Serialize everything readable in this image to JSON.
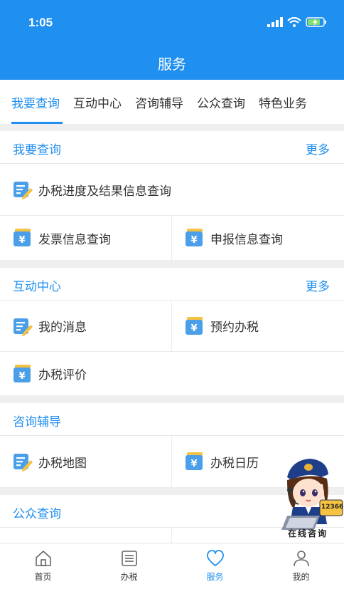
{
  "status_bar": {
    "time": "1:05"
  },
  "header": {
    "title": "服务"
  },
  "tabs": [
    "我要查询",
    "互动中心",
    "咨询辅导",
    "公众查询",
    "特色业务"
  ],
  "sections": {
    "query": {
      "title": "我要查询",
      "more": "更多",
      "items": [
        "办税进度及结果信息查询",
        "发票信息查询",
        "申报信息查询"
      ]
    },
    "interact": {
      "title": "互动中心",
      "more": "更多",
      "items": [
        "我的消息",
        "预约办税",
        "办税评价"
      ]
    },
    "consult": {
      "title": "咨询辅导",
      "items": [
        "办税地图",
        "办税日历"
      ]
    },
    "public": {
      "title": "公众查询"
    }
  },
  "mascot": {
    "label": "在线咨询",
    "hotline": "12366"
  },
  "bottom_nav": [
    "首页",
    "办税",
    "服务",
    "我的"
  ],
  "colors": {
    "accent": "#1f8ff0",
    "icon_gold": "#f5c242",
    "icon_blue": "#4a9fe8"
  },
  "icons": {
    "edit_doc": "edit-document-icon",
    "yuan_card": "yuan-card-icon",
    "home": "home-icon",
    "list": "list-icon",
    "heart": "heart-icon",
    "user": "user-icon"
  }
}
